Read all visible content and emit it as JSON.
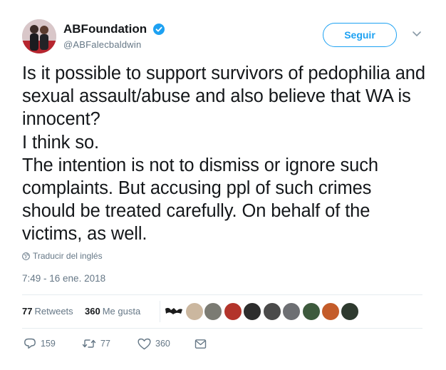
{
  "author": {
    "display_name": "ABFoundation",
    "handle": "@ABFalecbaldwin",
    "verified": true
  },
  "follow_button": {
    "label": "Seguir"
  },
  "tweet": {
    "lines": [
      "Is it possible to support survivors of pedophilia and sexual assault/abuse and also believe that WA is innocent?",
      "I think so.",
      "The intention is not to dismiss or ignore such complaints. But accusing ppl of such crimes should be treated carefully. On behalf of the victims, as well."
    ]
  },
  "translate_link": "Traducir del inglés",
  "timestamp": "7:49 - 16 ene. 2018",
  "stats": {
    "retweets_count": "77",
    "retweets_label": "Retweets",
    "likes_count": "360",
    "likes_label": "Me gusta"
  },
  "actions": {
    "replies": "159",
    "retweets": "77",
    "likes": "360"
  },
  "colors": {
    "accent": "#1da1f2",
    "text": "#14171a",
    "secondary": "#657786",
    "divider": "#e6ecf0"
  }
}
